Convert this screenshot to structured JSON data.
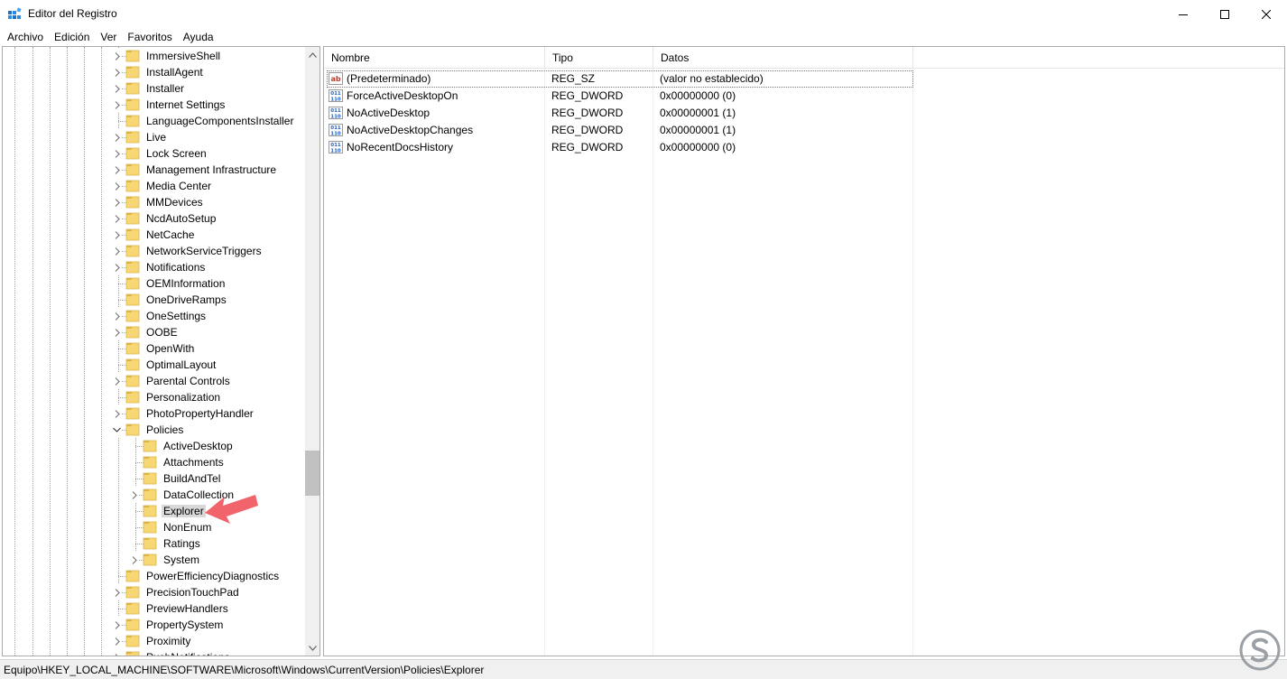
{
  "window": {
    "title": "Editor del Registro"
  },
  "menu": [
    {
      "label": "Archivo"
    },
    {
      "label": "Edición"
    },
    {
      "label": "Ver"
    },
    {
      "label": "Favoritos"
    },
    {
      "label": "Ayuda"
    }
  ],
  "tree": {
    "nodes": [
      {
        "label": "ImmersiveShell",
        "level": 1,
        "expander": "collapsed"
      },
      {
        "label": "InstallAgent",
        "level": 1,
        "expander": "collapsed"
      },
      {
        "label": "Installer",
        "level": 1,
        "expander": "collapsed"
      },
      {
        "label": "Internet Settings",
        "level": 1,
        "expander": "collapsed"
      },
      {
        "label": "LanguageComponentsInstaller",
        "level": 1,
        "expander": "none"
      },
      {
        "label": "Live",
        "level": 1,
        "expander": "collapsed"
      },
      {
        "label": "Lock Screen",
        "level": 1,
        "expander": "collapsed"
      },
      {
        "label": "Management Infrastructure",
        "level": 1,
        "expander": "collapsed"
      },
      {
        "label": "Media Center",
        "level": 1,
        "expander": "collapsed"
      },
      {
        "label": "MMDevices",
        "level": 1,
        "expander": "collapsed"
      },
      {
        "label": "NcdAutoSetup",
        "level": 1,
        "expander": "collapsed"
      },
      {
        "label": "NetCache",
        "level": 1,
        "expander": "collapsed"
      },
      {
        "label": "NetworkServiceTriggers",
        "level": 1,
        "expander": "collapsed"
      },
      {
        "label": "Notifications",
        "level": 1,
        "expander": "collapsed"
      },
      {
        "label": "OEMInformation",
        "level": 1,
        "expander": "none"
      },
      {
        "label": "OneDriveRamps",
        "level": 1,
        "expander": "none"
      },
      {
        "label": "OneSettings",
        "level": 1,
        "expander": "collapsed"
      },
      {
        "label": "OOBE",
        "level": 1,
        "expander": "collapsed"
      },
      {
        "label": "OpenWith",
        "level": 1,
        "expander": "none"
      },
      {
        "label": "OptimalLayout",
        "level": 1,
        "expander": "none"
      },
      {
        "label": "Parental Controls",
        "level": 1,
        "expander": "collapsed"
      },
      {
        "label": "Personalization",
        "level": 1,
        "expander": "none"
      },
      {
        "label": "PhotoPropertyHandler",
        "level": 1,
        "expander": "collapsed"
      },
      {
        "label": "Policies",
        "level": 1,
        "expander": "expanded"
      },
      {
        "label": "ActiveDesktop",
        "level": 2,
        "expander": "none"
      },
      {
        "label": "Attachments",
        "level": 2,
        "expander": "none"
      },
      {
        "label": "BuildAndTel",
        "level": 2,
        "expander": "none"
      },
      {
        "label": "DataCollection",
        "level": 2,
        "expander": "collapsed"
      },
      {
        "label": "Explorer",
        "level": 2,
        "expander": "none",
        "selected": true
      },
      {
        "label": "NonEnum",
        "level": 2,
        "expander": "none"
      },
      {
        "label": "Ratings",
        "level": 2,
        "expander": "none"
      },
      {
        "label": "System",
        "level": 2,
        "expander": "collapsed"
      },
      {
        "label": "PowerEfficiencyDiagnostics",
        "level": 1,
        "expander": "none"
      },
      {
        "label": "PrecisionTouchPad",
        "level": 1,
        "expander": "collapsed"
      },
      {
        "label": "PreviewHandlers",
        "level": 1,
        "expander": "none"
      },
      {
        "label": "PropertySystem",
        "level": 1,
        "expander": "collapsed"
      },
      {
        "label": "Proximity",
        "level": 1,
        "expander": "collapsed"
      },
      {
        "label": "PushNotifications",
        "level": 1,
        "expander": "collapsed"
      }
    ]
  },
  "list": {
    "columns": [
      {
        "label": "Nombre"
      },
      {
        "label": "Tipo"
      },
      {
        "label": "Datos"
      }
    ],
    "rows": [
      {
        "name": "(Predeterminado)",
        "type": "REG_SZ",
        "data": "(valor no establecido)",
        "icon": "string-value-icon",
        "focused": true
      },
      {
        "name": "ForceActiveDesktopOn",
        "type": "REG_DWORD",
        "data": "0x00000000 (0)",
        "icon": "dword-value-icon"
      },
      {
        "name": "NoActiveDesktop",
        "type": "REG_DWORD",
        "data": "0x00000001 (1)",
        "icon": "dword-value-icon"
      },
      {
        "name": "NoActiveDesktopChanges",
        "type": "REG_DWORD",
        "data": "0x00000001 (1)",
        "icon": "dword-value-icon"
      },
      {
        "name": "NoRecentDocsHistory",
        "type": "REG_DWORD",
        "data": "0x00000000 (0)",
        "icon": "dword-value-icon"
      }
    ]
  },
  "statusbar": {
    "path": "Equipo\\HKEY_LOCAL_MACHINE\\SOFTWARE\\Microsoft\\Windows\\CurrentVersion\\Policies\\Explorer"
  },
  "colors": {
    "folder": "#f7d774",
    "folder_edge": "#dcb445",
    "arrow": "#f2646c",
    "selection": "#d9d9d9",
    "watermark": "#9aa0a6"
  }
}
